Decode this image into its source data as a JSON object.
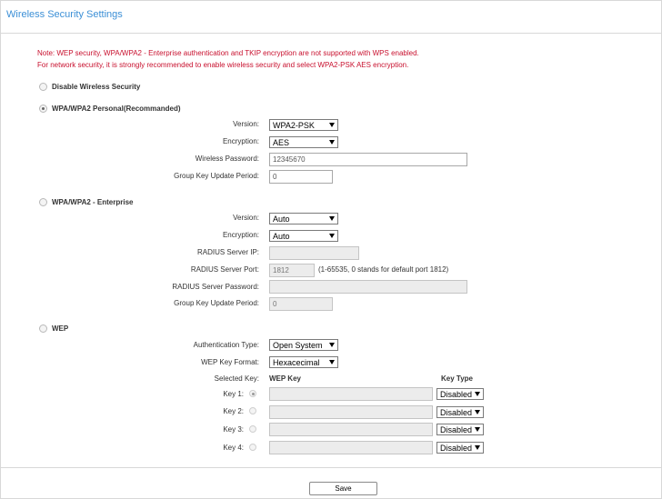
{
  "header": {
    "title": "Wireless Security Settings"
  },
  "notes": [
    "Note: WEP security, WPA/WPA2 - Enterprise authentication and TKIP encryption are not supported with WPS enabled.",
    "For network security, it is strongly recommended to enable wireless security and select WPA2-PSK AES encryption."
  ],
  "disable": {
    "label": "Disable Wireless Security"
  },
  "personal": {
    "label": "WPA/WPA2   Personal(Recommanded)",
    "version_label": "Version:",
    "version_value": "WPA2-PSK",
    "encryption_label": "Encryption:",
    "encryption_value": "AES",
    "password_label": "Wireless Password:",
    "password_value": "12345670",
    "group_key_label": "Group Key Update Period:",
    "group_key_value": "0"
  },
  "enterprise": {
    "label": "WPA/WPA2 - Enterprise",
    "version_label": "Version:",
    "version_value": "Auto",
    "encryption_label": "Encryption:",
    "encryption_value": "Auto",
    "radius_ip_label": "RADIUS Server IP:",
    "radius_ip_value": "",
    "radius_port_label": "RADIUS Server Port:",
    "radius_port_value": "1812",
    "radius_port_hint": "(1-65535, 0 stands for default port 1812)",
    "radius_password_label": "RADIUS Server Password:",
    "radius_password_value": "",
    "group_key_label": "Group Key Update Period:",
    "group_key_value": "0"
  },
  "wep": {
    "label": "WEP",
    "auth_label": "Authentication Type:",
    "auth_value": "Open System",
    "format_label": "WEP Key Format:",
    "format_value": "Hexacecimal",
    "selected_key_header": "Selected Key:",
    "wep_key_header": "WEP Key",
    "key_type_header": "Key Type",
    "keys": [
      {
        "label": "Key 1:",
        "value": "",
        "type": "Disabled",
        "selected": true
      },
      {
        "label": "Key 2:",
        "value": "",
        "type": "Disabled",
        "selected": false
      },
      {
        "label": "Key 3:",
        "value": "",
        "type": "Disabled",
        "selected": false
      },
      {
        "label": "Key 4:",
        "value": "",
        "type": "Disabled",
        "selected": false
      }
    ]
  },
  "footer": {
    "save_label": "Save"
  }
}
